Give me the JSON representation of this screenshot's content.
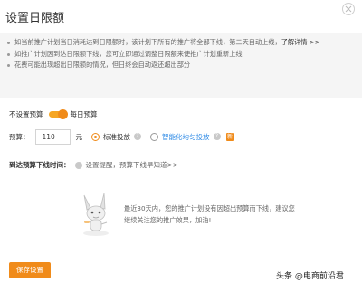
{
  "dialog": {
    "title": "设置日限额"
  },
  "info": {
    "item1_text": "如当前推广计划当日消耗达到日限额时，该计划下所有的推广将全部下线，第二天自动上线，",
    "item1_link": "了解详情 >>",
    "item2_text": "如推广计划因到达日限额下线，您可立即通过调整日限额来使推广计划重新上线",
    "item3_text": "花费可能出现超出日限额的情况，但日终会自动返还超出部分"
  },
  "budget_mode": {
    "off_label": "不设置预算",
    "on_label": "每日预算",
    "enabled": true
  },
  "budget": {
    "label": "预算：",
    "value": "110",
    "unit": "元",
    "option_standard": "标准投放",
    "option_smart": "智能化均匀投放",
    "selected": "标准投放",
    "new_badge": "新"
  },
  "reminder": {
    "label": "到达预算下线时间：",
    "link": "设置提醒，预算下线早知道>>"
  },
  "empty_state": {
    "text": "最近30天内，您的推广计划没有因超出预算而下线，建议您继续关注您的推广效果，加油!"
  },
  "actions": {
    "save_label": "保存设置"
  },
  "watermark": {
    "text": "头条 @电商前沿君"
  },
  "colors": {
    "accent": "#f08b1a",
    "link_blue": "#2f8be6",
    "info_bg": "#f5f5f5"
  }
}
